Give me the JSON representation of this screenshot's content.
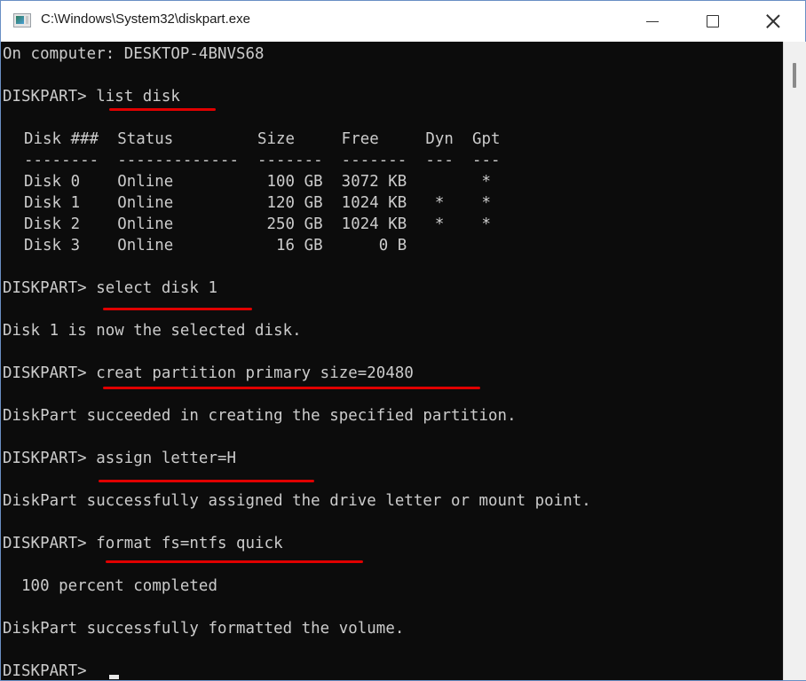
{
  "window": {
    "title": "C:\\Windows\\System32\\diskpart.exe",
    "icon": "console-app-icon",
    "controls": {
      "minimize": "minimize-icon",
      "maximize": "maximize-icon",
      "close": "close-icon"
    }
  },
  "console": {
    "header": "On computer: DESKTOP-4BNVS68",
    "prompt": "DISKPART> ",
    "commands": [
      "list disk",
      "select disk 1",
      "creat partition primary size=20480",
      "assign letter=H",
      "format fs=ntfs quick"
    ],
    "disk_table": {
      "header": "Disk ###  Status         Size     Free     Dyn  Gpt",
      "separator": "--------  -------------  -------  -------  ---  ---",
      "columns": [
        "Disk ###",
        "Status",
        "Size",
        "Free",
        "Dyn",
        "Gpt"
      ],
      "rows": [
        {
          "disk": "Disk 0",
          "status": "Online",
          "size": "100 GB",
          "free": "3072 KB",
          "dyn": "",
          "gpt": "*",
          "text": "Disk 0    Online          100 GB  3072 KB        *"
        },
        {
          "disk": "Disk 1",
          "status": "Online",
          "size": "120 GB",
          "free": "1024 KB",
          "dyn": "*",
          "gpt": "*",
          "text": "Disk 1    Online          120 GB  1024 KB   *    *"
        },
        {
          "disk": "Disk 2",
          "status": "Online",
          "size": "250 GB",
          "free": "1024 KB",
          "dyn": "*",
          "gpt": "*",
          "text": "Disk 2    Online          250 GB  1024 KB   *    *"
        },
        {
          "disk": "Disk 3",
          "status": "Online",
          "size": "16 GB",
          "free": "0 B",
          "dyn": "",
          "gpt": "",
          "text": "Disk 3    Online           16 GB      0 B"
        }
      ]
    },
    "outputs": {
      "select": "Disk 1 is now the selected disk.",
      "create": "DiskPart succeeded in creating the specified partition.",
      "assign": "DiskPart successfully assigned the drive letter or mount point.",
      "progress": "  100 percent completed",
      "format": "DiskPart successfully formatted the volume."
    },
    "final_prompt": "DISKPART> "
  },
  "colors": {
    "console_bg": "#0c0c0c",
    "console_text": "#cccccc",
    "annotation_underline": "#e00000"
  }
}
